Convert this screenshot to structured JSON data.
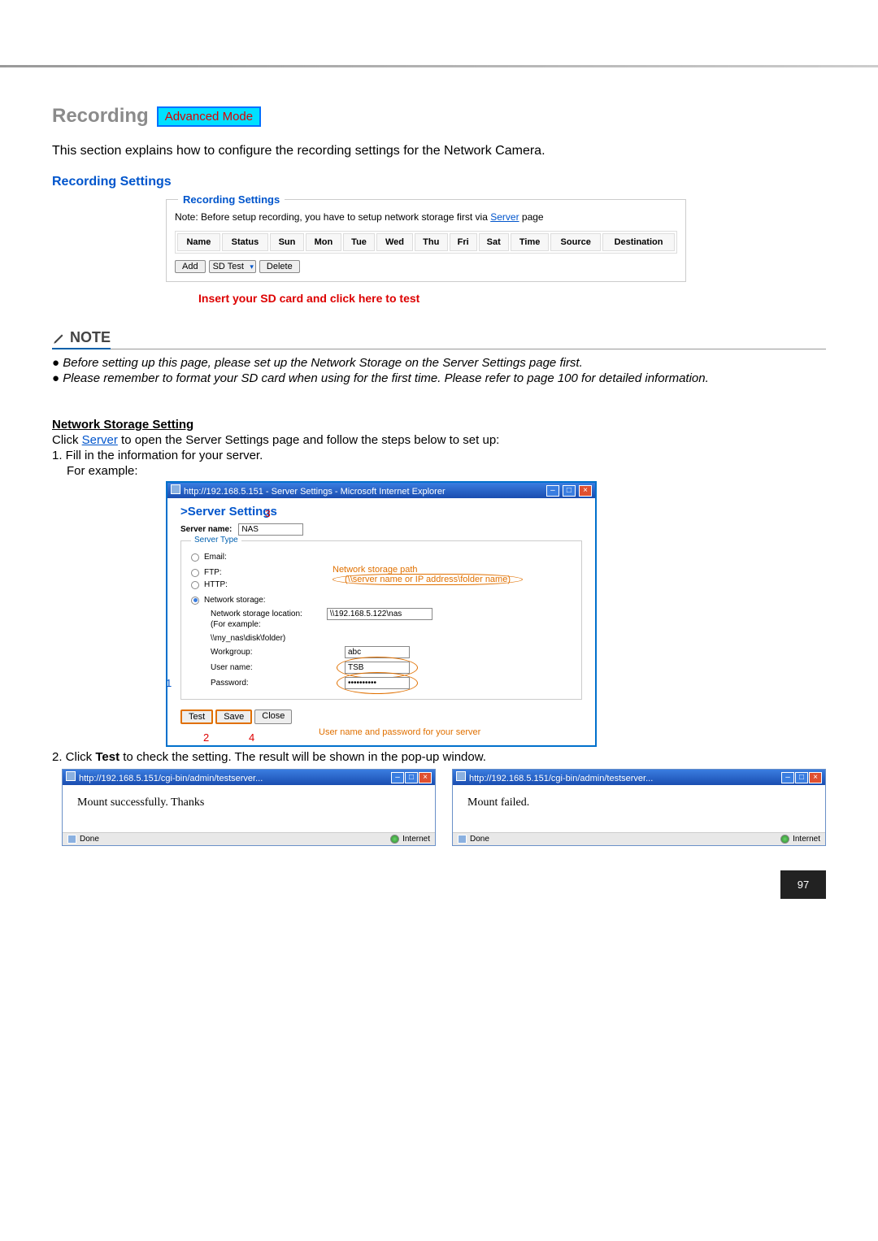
{
  "title": "Recording",
  "badge": "Advanced Mode",
  "intro": "This section explains how to configure the recording settings for the Network Camera.",
  "subhead": "Recording Settings",
  "recBox": {
    "legend": "Recording Settings",
    "note_pre": "Note: Before setup recording, you have to setup network storage first via ",
    "note_link": "Server",
    "note_post": " page",
    "cols": [
      "Name",
      "Status",
      "Sun",
      "Mon",
      "Tue",
      "Wed",
      "Thu",
      "Fri",
      "Sat",
      "Time",
      "Source",
      "Destination"
    ],
    "add": "Add",
    "sd": "SD Test",
    "delete": "Delete"
  },
  "sdHint": "Insert your SD card and click here to test",
  "noteLabel": "NOTE",
  "noteItems": [
    "● Before setting up this page, please set up the Network Storage on the Server Settings page first.",
    "● Please remember to format your SD card when using for the first time. Please refer to page 100 for detailed information."
  ],
  "nsHead": "Network Storage Setting",
  "nsTextPre": "Click ",
  "nsTextLink": "Server",
  "nsTextPost": " to open the Server Settings page and follow the steps below to set up:",
  "step1": "1. Fill in the information for your server.",
  "forExample": "For example:",
  "ie": {
    "title": "http://192.168.5.151 - Server Settings - Microsoft Internet Explorer",
    "header": ">Server Settings",
    "nameLabel": "Server name:",
    "nameVal": "NAS",
    "typeLegend": "Server Type",
    "email": "Email:",
    "ftp": "FTP:",
    "http": "HTTP:",
    "ns": "Network storage:",
    "pathL1": "Network storage path",
    "pathL2": "(\\\\server name or IP address\\folder name)",
    "locLabel": "Network storage location:",
    "locVal": "\\\\192.168.5.122\\nas",
    "locEx1": "(For example:",
    "locEx2": "\\\\my_nas\\disk\\folder)",
    "wgLabel": "Workgroup:",
    "wgVal": "abc",
    "userLabel": "User name:",
    "userVal": "TSB",
    "pwLabel": "Password:",
    "pwVal": "••••••••••",
    "test": "Test",
    "save": "Save",
    "close": "Close",
    "orangeNote": "User name and password for your server"
  },
  "num3": "3",
  "num1": "1",
  "num2": "2",
  "num4": "4",
  "step2pre": "2. Click ",
  "step2b": "Test",
  "step2post": " to check the setting. The result will be shown in the pop-up window.",
  "mini": {
    "title": "http://192.168.5.151/cgi-bin/admin/testserver...",
    "ok": "Mount successfully. Thanks",
    "fail": "Mount failed.",
    "done": "Done",
    "internet": "Internet"
  },
  "pageNum": "97"
}
